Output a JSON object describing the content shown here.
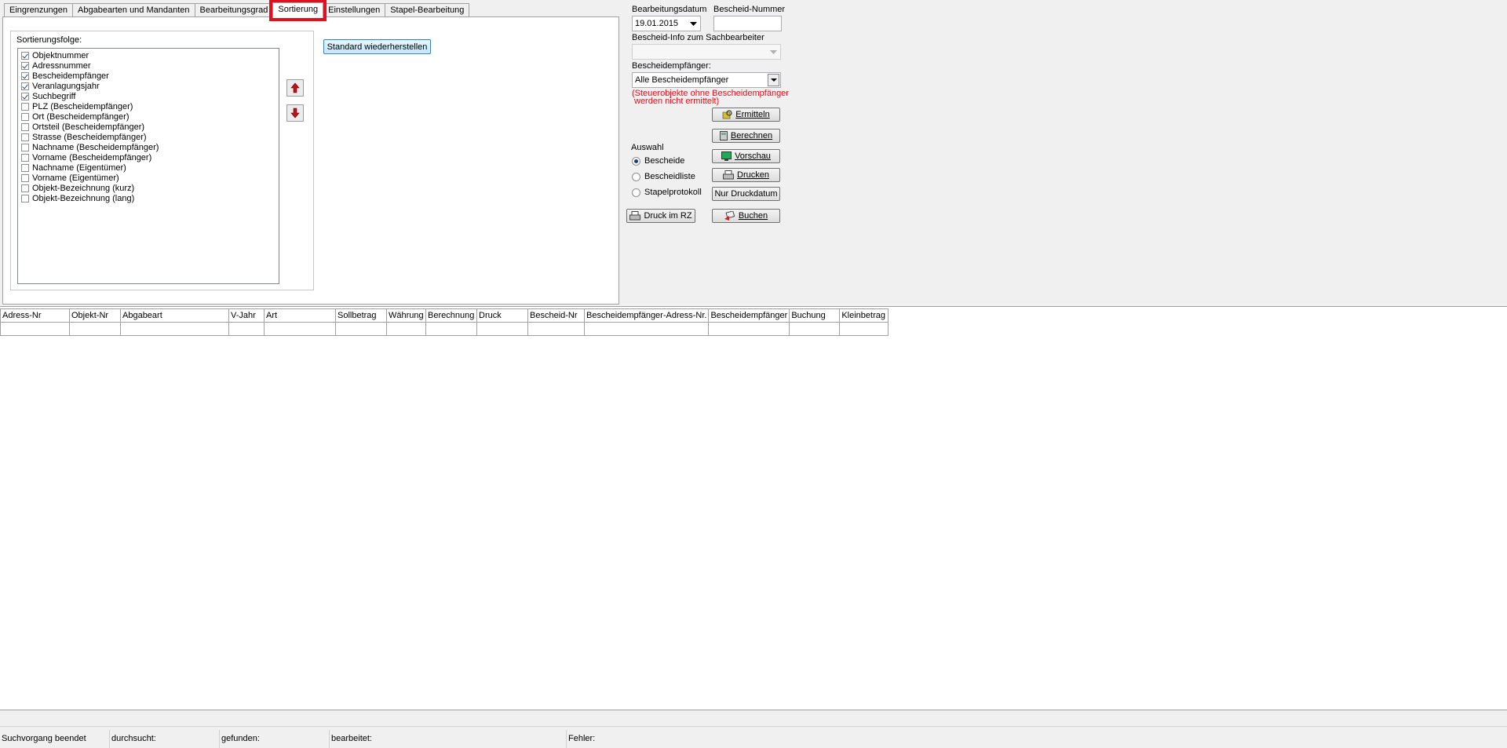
{
  "tabs": [
    {
      "label": "Eingrenzungen"
    },
    {
      "label": "Abgabearten und Mandanten"
    },
    {
      "label": "Bearbeitungsgrad"
    },
    {
      "label": "Sortierung"
    },
    {
      "label": "Einstellungen"
    },
    {
      "label": "Stapel-Bearbeitung"
    }
  ],
  "active_tab": "Sortierung",
  "sortierung": {
    "group_label": "Sortierungsfolge:",
    "items": [
      {
        "label": "Objektnummer",
        "checked": true
      },
      {
        "label": "Adressnummer",
        "checked": true
      },
      {
        "label": "Bescheidempfänger",
        "checked": true
      },
      {
        "label": "Veranlagungsjahr",
        "checked": true
      },
      {
        "label": "Suchbegriff",
        "checked": true
      },
      {
        "label": "PLZ (Bescheidempfänger)",
        "checked": false
      },
      {
        "label": "Ort (Bescheidempfänger)",
        "checked": false
      },
      {
        "label": "Ortsteil (Bescheidempfänger)",
        "checked": false
      },
      {
        "label": "Strasse (Bescheidempfänger)",
        "checked": false
      },
      {
        "label": "Nachname (Bescheidempfänger)",
        "checked": false
      },
      {
        "label": "Vorname (Bescheidempfänger)",
        "checked": false
      },
      {
        "label": "Nachname (Eigentümer)",
        "checked": false
      },
      {
        "label": "Vorname (Eigentümer)",
        "checked": false
      },
      {
        "label": "Objekt-Bezeichnung (kurz)",
        "checked": false
      },
      {
        "label": "Objekt-Bezeichnung (lang)",
        "checked": false
      }
    ],
    "restore_button": "Standard wiederherstellen"
  },
  "right_panel": {
    "bearbeitungsdatum_label": "Bearbeitungsdatum",
    "bearbeitungsdatum_value": "19.01.2015",
    "bescheid_nummer_label": "Bescheid-Nummer",
    "bescheid_nummer_value": "",
    "info_label": "Bescheid-Info zum Sachbearbeiter",
    "info_value": "",
    "empfaenger_label": "Bescheidempfänger:",
    "empfaenger_value": "Alle Bescheidempfänger",
    "warning_line1": "(Steuerobjekte ohne Bescheidempfänger",
    "warning_line2": "werden nicht ermittelt)",
    "auswahl_label": "Auswahl",
    "radios": [
      {
        "label": "Bescheide",
        "selected": true
      },
      {
        "label": "Bescheidliste",
        "selected": false
      },
      {
        "label": "Stapelprotokoll",
        "selected": false
      }
    ],
    "buttons": {
      "ermitteln": "Ermitteln",
      "berechnen": "Berechnen",
      "vorschau": "Vorschau",
      "drucken": "Drucken",
      "nur_druckdatum": "Nur Druckdatum",
      "buchen": "Buchen",
      "druck_im_rz": "Druck im RZ"
    }
  },
  "grid": {
    "columns": [
      "Adress-Nr",
      "Objekt-Nr",
      "Abgabeart",
      "V-Jahr",
      "Art",
      "Sollbetrag",
      "Währung",
      "Berechnung",
      "Druck",
      "Bescheid-Nr",
      "Bescheidempfänger-Adress-Nr.",
      "Bescheidempfänger",
      "Buchung",
      "Kleinbetrag"
    ]
  },
  "status": {
    "suchvorgang": "Suchvorgang beendet",
    "durchsucht": "durchsucht:",
    "gefunden": "gefunden:",
    "bearbeitet": "bearbeitet:",
    "fehler": "Fehler:"
  },
  "colors": {
    "highlight": "#e0101e",
    "warning_text": "#e0101e"
  }
}
